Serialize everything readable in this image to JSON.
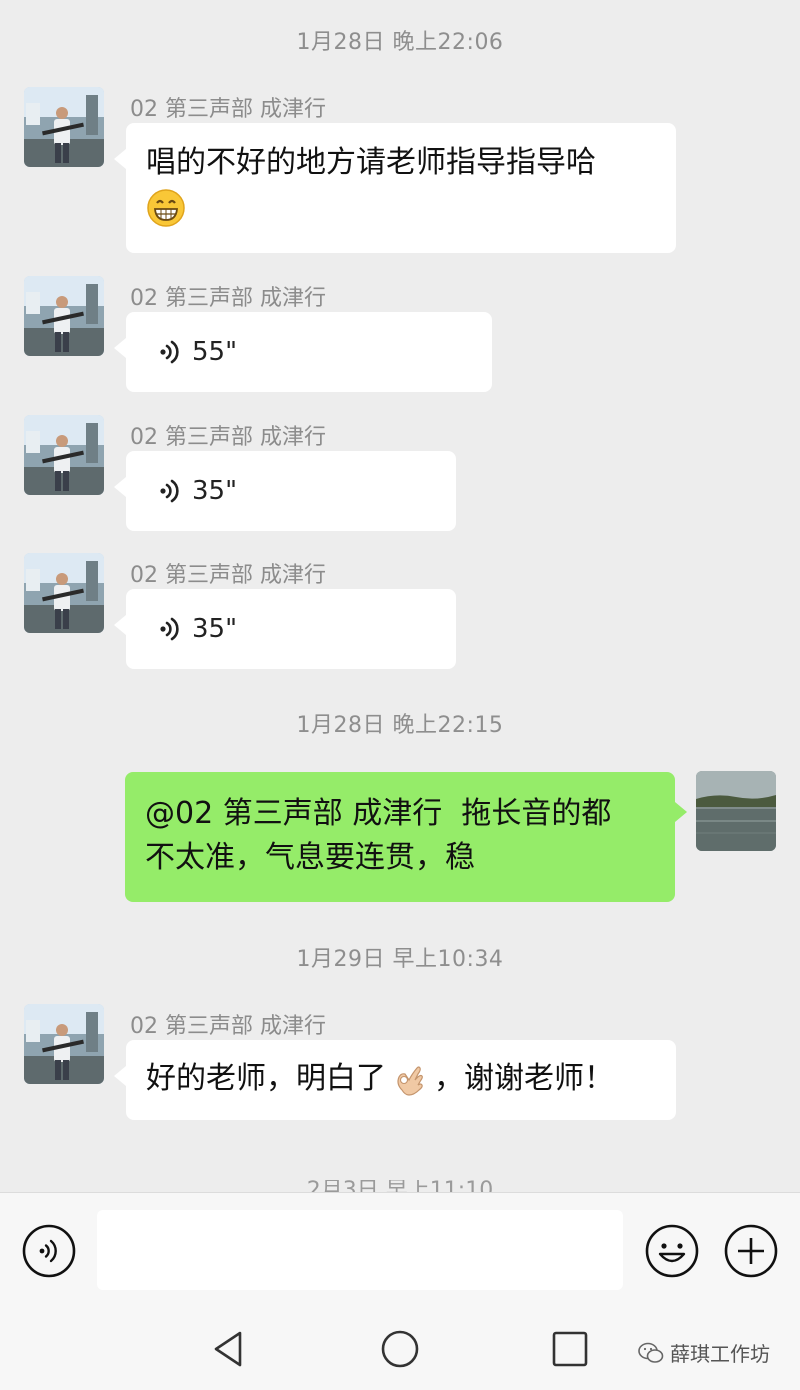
{
  "colors": {
    "background": "#ededed",
    "bubble_in": "#ffffff",
    "bubble_out": "#95ec69",
    "timestamp": "#8e8e8e"
  },
  "timestamps": [
    "1月28日 晚上22:06",
    "1月28日 晚上22:15",
    "1月29日 早上10:34"
  ],
  "partial_timestamp": "2月3日 早上11:10",
  "sender_name": "02 第三声部 成津行",
  "messages": [
    {
      "type": "text",
      "line1": "唱的不好的地方请老师指导指导哈",
      "emoji": "grinning-face-icon"
    },
    {
      "type": "voice",
      "duration": "55\""
    },
    {
      "type": "voice",
      "duration": "35\""
    },
    {
      "type": "voice",
      "duration": "35\""
    },
    {
      "type": "outgoing",
      "line1": "@02 第三声部 成津行  拖长音的都",
      "line2": "不太准，气息要连贯，稳"
    },
    {
      "type": "text",
      "before": "好的老师，明白了",
      "emoji": "ok-hand-icon",
      "after": "，谢谢老师！"
    }
  ],
  "input": {
    "placeholder": ""
  },
  "watermark": "薛琪工作坊"
}
